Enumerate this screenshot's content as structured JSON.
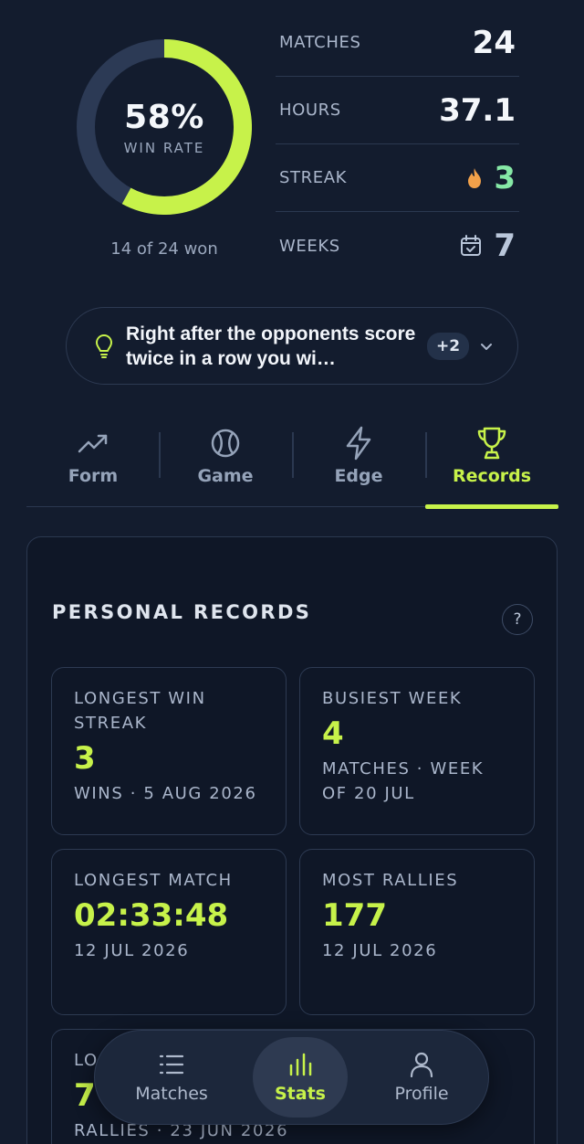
{
  "hero": {
    "win_rate_text": "58%",
    "win_rate_fraction": 0.58,
    "win_rate_label": "WIN RATE",
    "won_summary": "14 of 24 won",
    "ring_track_color": "#2c3a55",
    "ring_fill_color": "#c7f24a",
    "stats": [
      {
        "label": "MATCHES",
        "value": "24",
        "icon": ""
      },
      {
        "label": "HOURS",
        "value": "37.1",
        "icon": ""
      },
      {
        "label": "STREAK",
        "value": "3",
        "icon": "flame-icon"
      },
      {
        "label": "WEEKS",
        "value": "7",
        "icon": "calendar-check-icon"
      }
    ]
  },
  "insight": {
    "icon": "lightbulb-icon",
    "text": "Right after the opponents score twice in a row you wi…",
    "badge": "+2",
    "expand_icon": "chevron-down-icon"
  },
  "tabs": [
    {
      "label": "Form",
      "icon": "trend-up-icon",
      "active": false
    },
    {
      "label": "Game",
      "icon": "ball-icon",
      "active": false
    },
    {
      "label": "Edge",
      "icon": "lightning-icon",
      "active": false
    },
    {
      "label": "Records",
      "icon": "trophy-icon",
      "active": true
    }
  ],
  "records": {
    "title": "PERSONAL RECORDS",
    "help_label": "?",
    "items": [
      {
        "label": "LONGEST WIN STREAK",
        "value": "3",
        "sub": "WINS · 5 AUG 2026"
      },
      {
        "label": "BUSIEST WEEK",
        "value": "4",
        "sub": "MATCHES · WEEK OF 20 JUL"
      },
      {
        "label": "LONGEST MATCH",
        "value": "02:33:48",
        "sub": "12 JUL 2026"
      },
      {
        "label": "MOST RALLIES",
        "value": "177",
        "sub": "12 JUL 2026"
      },
      {
        "label": "LO",
        "value": "7",
        "sub": "RALLIES · 23 JUN 2026"
      }
    ]
  },
  "nav": {
    "items": [
      {
        "label": "Matches",
        "icon": "list-icon",
        "active": false
      },
      {
        "label": "Stats",
        "icon": "bar-chart-icon",
        "active": true
      },
      {
        "label": "Profile",
        "icon": "person-icon",
        "active": false
      }
    ]
  },
  "colors": {
    "accent": "#c7f24a",
    "background": "#131c2e",
    "panel": "#0f1727",
    "streak_value": "#86e8a6",
    "flame": "#f2a14a"
  }
}
